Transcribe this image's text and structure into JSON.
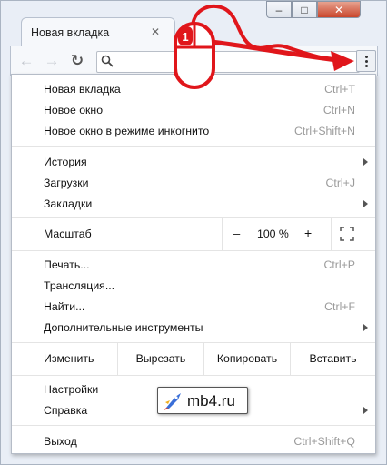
{
  "tab": {
    "title": "Новая вкладка"
  },
  "window_controls": {
    "minimize": "–",
    "maximize": "□",
    "close": "✕"
  },
  "omnibox": {
    "value": "",
    "placeholder": ""
  },
  "menu": {
    "group1": [
      {
        "label": "Новая вкладка",
        "shortcut": "Ctrl+T"
      },
      {
        "label": "Новое окно",
        "shortcut": "Ctrl+N"
      },
      {
        "label": "Новое окно в режиме инкогнито",
        "shortcut": "Ctrl+Shift+N"
      }
    ],
    "group2": [
      {
        "label": "История",
        "shortcut": ""
      },
      {
        "label": "Загрузки",
        "shortcut": "Ctrl+J"
      },
      {
        "label": "Закладки",
        "shortcut": ""
      }
    ],
    "zoom": {
      "label": "Масштаб",
      "minus": "–",
      "value": "100 %",
      "plus": "+"
    },
    "group3": [
      {
        "label": "Печать...",
        "shortcut": "Ctrl+P"
      },
      {
        "label": "Трансляция...",
        "shortcut": ""
      },
      {
        "label": "Найти...",
        "shortcut": "Ctrl+F"
      },
      {
        "label": "Дополнительные инструменты",
        "shortcut": ""
      }
    ],
    "edit": {
      "label": "Изменить",
      "cut": "Вырезать",
      "copy": "Копировать",
      "paste": "Вставить"
    },
    "group4": [
      {
        "label": "Настройки",
        "shortcut": ""
      },
      {
        "label": "Справка",
        "shortcut": ""
      }
    ],
    "exit": {
      "label": "Выход",
      "shortcut": "Ctrl+Shift+Q"
    }
  },
  "annotation": {
    "step_number": "1"
  },
  "watermark": {
    "text": "mb4.ru"
  },
  "colors": {
    "annotation_red": "#e0161b",
    "window_frame": "#e9eef6"
  }
}
